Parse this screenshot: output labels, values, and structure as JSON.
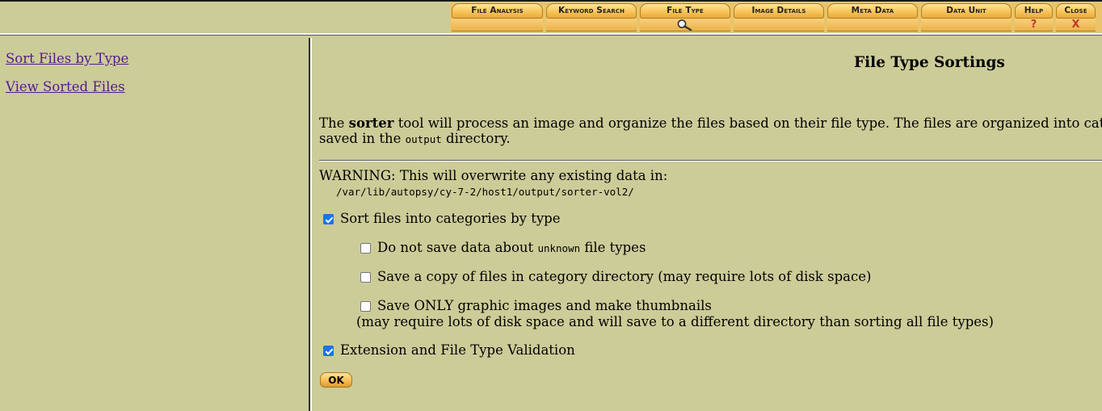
{
  "tabs": [
    {
      "label": "File Analysis",
      "lower": ""
    },
    {
      "label": "Keyword Search",
      "lower": ""
    },
    {
      "label": "File Type",
      "lower": ""
    },
    {
      "label": "Image Details",
      "lower": ""
    },
    {
      "label": "Meta Data",
      "lower": ""
    },
    {
      "label": "Data Unit",
      "lower": ""
    },
    {
      "label": "Help",
      "lower": "?"
    },
    {
      "label": "Close",
      "lower": "X"
    }
  ],
  "icons": {
    "active_tab": "magnifier-icon"
  },
  "nav": {
    "sort_files": "Sort Files by Type",
    "view_sorted": "View Sorted Files"
  },
  "main": {
    "title": "File Type Sortings",
    "intro_pre": "The ",
    "intro_tool": "sorter",
    "intro_post": " tool will process an image and organize the files based on their file type. The files are organized into catego",
    "intro_line2_pre": "saved in the ",
    "intro_line2_code": "output",
    "intro_line2_post": " directory.",
    "warning": "WARNING: This will overwrite any existing data in:",
    "path": "/var/lib/autopsy/cy-7-2/host1/output/sorter-vol2/",
    "opt_sort": {
      "label": "Sort files into categories by type",
      "checked": true
    },
    "opt_unknown": {
      "label_pre": "Do not save data about ",
      "label_code": "unknown",
      "label_post": " file types",
      "checked": false
    },
    "opt_copy": {
      "label": "Save a copy of files in category directory (may require lots of disk space)",
      "checked": false
    },
    "opt_images": {
      "label": "Save ONLY graphic images and make thumbnails",
      "note": "(may require lots of disk space and will save to a different directory than sorting all file types)",
      "checked": false
    },
    "opt_ext": {
      "label": "Extension and File Type Validation",
      "checked": true
    },
    "ok_label": "OK"
  },
  "colors": {
    "background": "#cccc99",
    "tab": "#f7c257",
    "link": "#551a8b",
    "checkbox_checked": "#1a73e8"
  }
}
